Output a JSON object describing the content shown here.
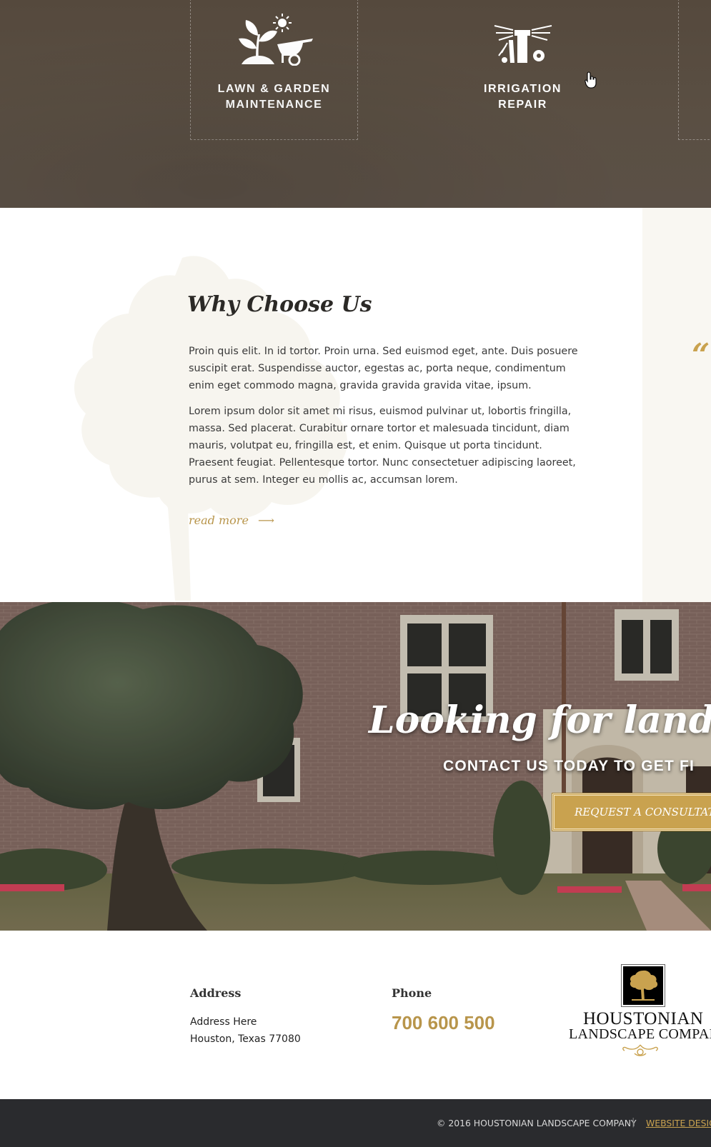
{
  "services": {
    "items": [
      {
        "label": "LAWN & GARDEN\nMAINTENANCE",
        "icon": "plant-wheelbarrow-icon"
      },
      {
        "label": "IRRIGATION\nREPAIR",
        "icon": "sprinkler-icon"
      }
    ]
  },
  "why": {
    "title": "Why Choose Us",
    "paragraphs": [
      "Proin quis elit. In id tortor. Proin urna. Sed euismod eget, ante. Duis posuere suscipit erat. Suspendisse auctor, egestas ac, porta neque, condimentum enim eget commodo magna, gravida gravida gravida vitae, ipsum.",
      "Lorem ipsum dolor sit amet mi risus, euismod pulvinar ut, lobortis fringilla, massa. Sed placerat. Curabitur ornare tortor et malesuada tincidunt, diam mauris, volutpat eu, fringilla est, et enim. Quisque ut porta tincidunt. Praesent feugiat. Pellentesque tortor.  Nunc consectetuer adipiscing laoreet, purus at sem. Integer eu mollis ac, accumsan lorem."
    ],
    "read_more": "read more",
    "read_more_arrow": "⟶",
    "quote_mark": "“"
  },
  "cta": {
    "title": "Looking for landscap",
    "subtitle": "CONTACT US TODAY TO GET FI",
    "button": "REQUEST A CONSULTATION"
  },
  "contact": {
    "address_heading": "Address",
    "address": "Address Here\nHouston, Texas 77080",
    "phone_heading": "Phone",
    "phone": "700 600 500",
    "logo_line1": "HOUSTONIAN",
    "logo_line2": "LANDSCAPE COMPANY"
  },
  "footer": {
    "copyright": "© 2016 HOUSTONIAN LANDSCAPE COMPANY",
    "separator": "|",
    "design_link": "WEBSITE DESIGN"
  },
  "colors": {
    "accent": "#c9a24f",
    "services_bg": "#5a4f43",
    "footer_bg": "#2a2b2e"
  }
}
